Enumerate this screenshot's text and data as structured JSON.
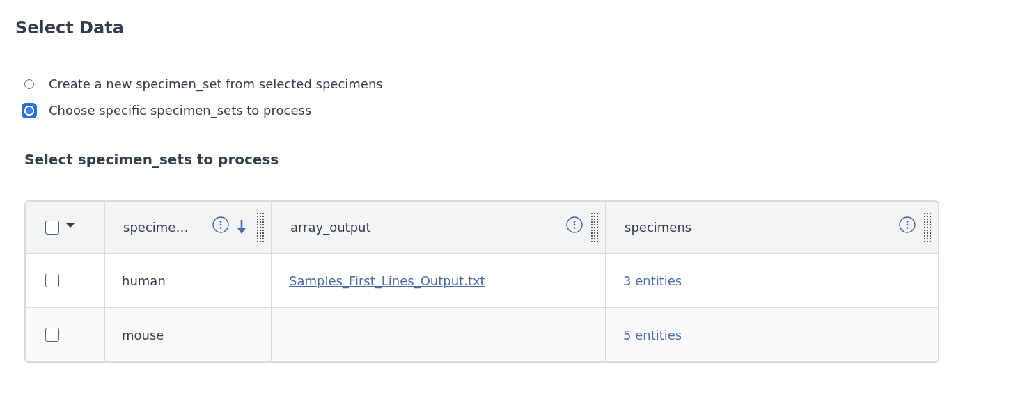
{
  "title": "Select Data",
  "options": [
    {
      "label": "Create a new specimen_set from selected specimens",
      "selected": false
    },
    {
      "label": "Choose specific specimen_sets to process",
      "selected": true
    }
  ],
  "section_title": "Select specimen_sets to process",
  "table": {
    "select_all": {
      "checked": false
    },
    "columns": [
      {
        "label": "specime…",
        "sorted": true
      },
      {
        "label": "array_output",
        "sorted": false
      },
      {
        "label": "specimens",
        "sorted": false
      }
    ],
    "rows": [
      {
        "checked": false,
        "cells": [
          {
            "kind": "text",
            "text": "human"
          },
          {
            "kind": "link",
            "text": "Samples_First_Lines_Output.txt"
          },
          {
            "kind": "count",
            "text": "3 entities"
          }
        ]
      },
      {
        "checked": false,
        "cells": [
          {
            "kind": "text",
            "text": "mouse"
          },
          {
            "kind": "empty"
          },
          {
            "kind": "count",
            "text": "5 entities"
          }
        ]
      }
    ]
  }
}
